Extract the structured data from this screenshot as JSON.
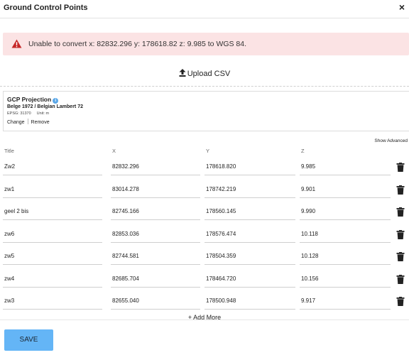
{
  "dialog": {
    "title": "Ground Control Points",
    "close_label": "×"
  },
  "alert": {
    "message": "Unable to convert x: 82832.296 y: 178618.82 z: 9.985 to WGS 84.",
    "color": "#fbe3e4",
    "icon": "warning-icon"
  },
  "upload": {
    "label": "Upload CSV",
    "icon": "upload-icon"
  },
  "projection": {
    "title": "GCP Projection",
    "info_icon": "i",
    "name": "Belge 1972 / Belgian Lambert 72",
    "epsg": "EPSG: 31370",
    "unit": "Unit: m",
    "change_label": "Change",
    "remove_label": "Remove"
  },
  "show_advanced_label": "Show Advanced",
  "table": {
    "headers": {
      "title": "Title",
      "x": "X",
      "y": "Y",
      "z": "Z"
    },
    "rows": [
      {
        "title": "Zw2",
        "x": "82832.296",
        "y": "178618.820",
        "z": "9.985"
      },
      {
        "title": "zw1",
        "x": "83014.278",
        "y": "178742.219",
        "z": "9.901"
      },
      {
        "title": "geel 2 bis",
        "x": "82745.166",
        "y": "178560.145",
        "z": "9.990"
      },
      {
        "title": "zw6",
        "x": "82853.036",
        "y": "178576.474",
        "z": "10.118"
      },
      {
        "title": "zw5",
        "x": "82744.581",
        "y": "178504.359",
        "z": "10.128"
      },
      {
        "title": "zw4",
        "x": "82685.704",
        "y": "178464.720",
        "z": "10.156"
      },
      {
        "title": "zw3",
        "x": "82655.040",
        "y": "178500.948",
        "z": "9.917"
      }
    ]
  },
  "add_more_label": "+ Add More",
  "save_label": "SAVE",
  "colors": {
    "save_button": "#64b5f6",
    "alert_bg": "#fbe3e4",
    "alert_icon": "#c62828",
    "info_icon": "#5aa7e8"
  }
}
